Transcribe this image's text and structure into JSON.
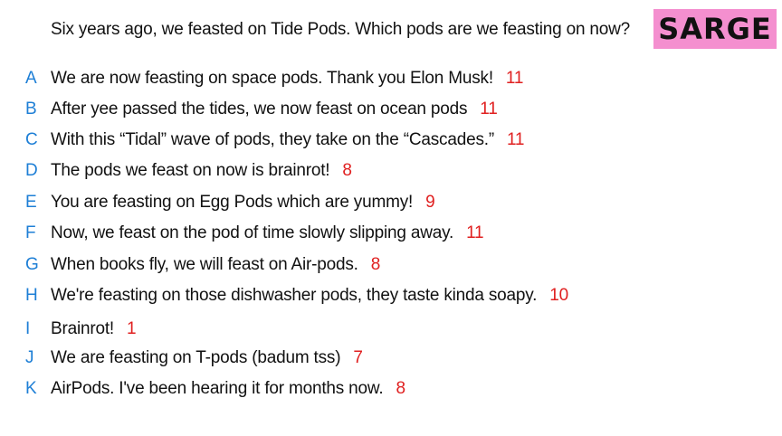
{
  "question": "Six years ago, we feasted on Tide Pods. Which pods are we feasting on now?",
  "badge": "SARGE",
  "colors": {
    "badge_bg": "#f48fcf",
    "letter": "#1e7fd6",
    "score": "#e02020",
    "text": "#111111"
  },
  "answers": [
    {
      "letter": "A",
      "text": "We are now feasting on space pods. Thank you Elon Musk!",
      "score": "11"
    },
    {
      "letter": "B",
      "text": "After yee passed the tides, we now feast on ocean pods",
      "score": "11"
    },
    {
      "letter": "C",
      "text": "With this “Tidal” wave of pods, they take on the “Cascades.”",
      "score": "11"
    },
    {
      "letter": "D",
      "text": "The pods we feast on now is brainrot!",
      "score": "8"
    },
    {
      "letter": "E",
      "text": "You are feasting on Egg Pods which are yummy!",
      "score": "9"
    },
    {
      "letter": "F",
      "text": "Now, we feast on the pod of time slowly slipping away.",
      "score": "11"
    },
    {
      "letter": "G",
      "text": "When books fly, we will feast on Air-pods.",
      "score": "8"
    },
    {
      "letter": "H",
      "text": "We're feasting on those dishwasher pods, they taste kinda soapy.",
      "score": "10"
    },
    {
      "letter": "I",
      "text": "Brainrot!",
      "score": "1"
    },
    {
      "letter": "J",
      "text": "We are feasting on T-pods (badum tss)",
      "score": "7"
    },
    {
      "letter": "K",
      "text": "AirPods. I've been hearing it for months now.",
      "score": "8"
    }
  ]
}
